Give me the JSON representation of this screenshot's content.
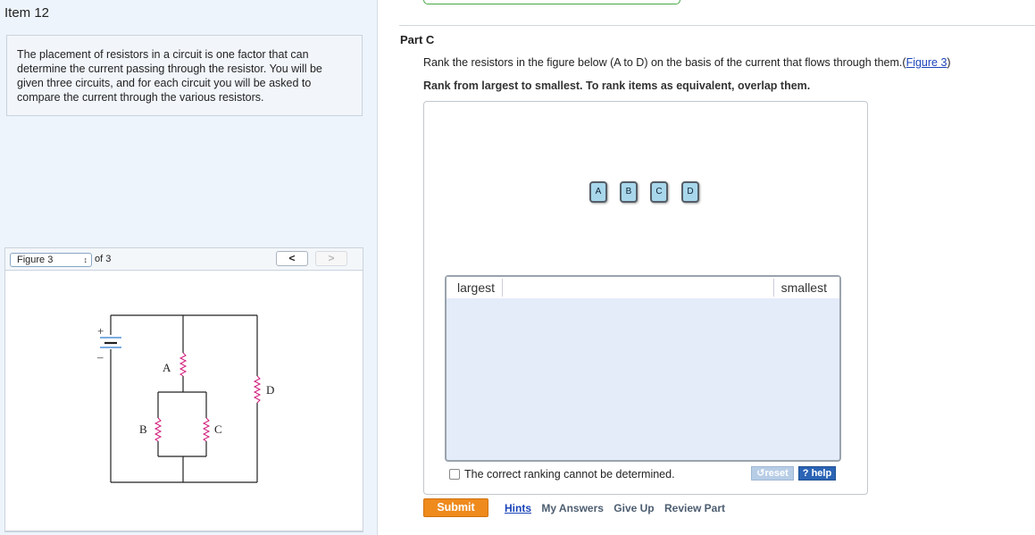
{
  "item": {
    "title": "Item 12"
  },
  "intro": {
    "text": "The placement of resistors in a circuit is one factor that can determine the current passing through the resistor. You will be given three circuits, and for each circuit you will be asked to compare the current through the various resistors."
  },
  "figure_nav": {
    "selected": "Figure 3",
    "of_text": "of 3",
    "prev_label": "<",
    "next_label": ">"
  },
  "circuit": {
    "battery_plus": "+",
    "battery_minus": "–",
    "resistor_labels": {
      "a": "A",
      "b": "B",
      "c": "C",
      "d": "D"
    }
  },
  "part": {
    "title": "Part C",
    "question_text": "Rank the resistors in the figure below (A to D) on the basis of the current that flows through them.",
    "figure_link_open": "(",
    "figure_link": "Figure 3",
    "figure_link_close": ")",
    "instruction": "Rank from largest to smallest. To rank items as equivalent, overlap them."
  },
  "ranking": {
    "tiles": [
      "A",
      "B",
      "C",
      "D"
    ],
    "largest_label": "largest",
    "smallest_label": "smallest",
    "cannot_determine": "The correct ranking cannot be determined.",
    "reset_label": "reset",
    "help_label": "? help"
  },
  "actions": {
    "submit": "Submit",
    "hints": "Hints",
    "my_answers": "My Answers",
    "give_up": "Give Up",
    "review_part": "Review Part"
  },
  "colors": {
    "submit": "#ef8a1d",
    "tile_fill": "#a8d7ec",
    "ranking_area": "#e4ebf9",
    "help_button": "#2b64b5",
    "resistor": "#d0197a",
    "link": "#1a44b8"
  }
}
